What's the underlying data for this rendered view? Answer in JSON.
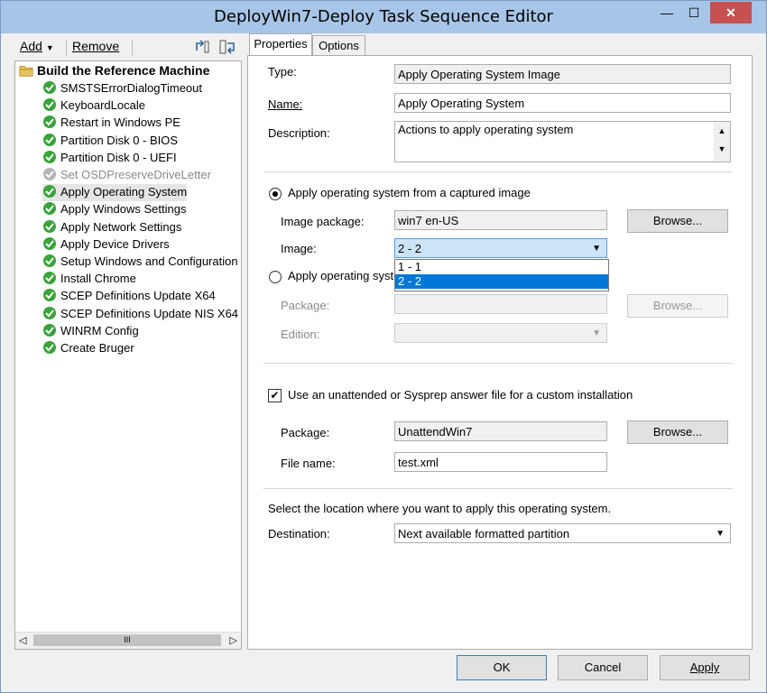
{
  "window": {
    "title": "DeployWin7-Deploy Task Sequence Editor",
    "min_glyph": "—",
    "max_glyph": "☐",
    "close_glyph": "✕"
  },
  "toolbar": {
    "add_label": "Add",
    "remove_label": "Remove"
  },
  "tree": {
    "root": "Build the Reference Machine",
    "items": [
      {
        "label": "SMSTSErrorDialogTimeout",
        "state": "ok"
      },
      {
        "label": "KeyboardLocale",
        "state": "ok"
      },
      {
        "label": "Restart in Windows PE",
        "state": "ok"
      },
      {
        "label": "Partition Disk 0 - BIOS",
        "state": "ok"
      },
      {
        "label": "Partition Disk 0 - UEFI",
        "state": "ok"
      },
      {
        "label": "Set OSDPreserveDriveLetter",
        "state": "disabled"
      },
      {
        "label": "Apply Operating System",
        "state": "ok"
      },
      {
        "label": "Apply Windows Settings",
        "state": "ok"
      },
      {
        "label": "Apply Network Settings",
        "state": "ok"
      },
      {
        "label": "Apply Device Drivers",
        "state": "ok"
      },
      {
        "label": "Setup Windows and Configuration",
        "state": "ok"
      },
      {
        "label": "Install Chrome",
        "state": "ok"
      },
      {
        "label": "SCEP Definitions Update X64",
        "state": "ok"
      },
      {
        "label": "SCEP Definitions Update NIS X64",
        "state": "ok"
      },
      {
        "label": "WINRM Config",
        "state": "ok"
      },
      {
        "label": "Create Bruger",
        "state": "ok"
      }
    ],
    "scroll_mid": "III"
  },
  "tabs": {
    "properties": "Properties",
    "options": "Options"
  },
  "props": {
    "type_label": "Type:",
    "type_value": "Apply Operating System Image",
    "name_label": "Name:",
    "name_value": "Apply Operating System",
    "description_label": "Description:",
    "description_value": "Actions to apply operating system",
    "radio_captured": "Apply operating system from a captured image",
    "image_package_label": "Image package:",
    "image_package_value": "win7  en-US",
    "browse": "Browse...",
    "image_label": "Image:",
    "image_value": "2 - 2",
    "image_options": [
      "1 - 1",
      "2 - 2"
    ],
    "radio_other": "Apply operating syste",
    "package_label": "Package:",
    "edition_label": "Edition:",
    "unattend_check": "Use an unattended or Sysprep answer file for a custom installation",
    "unattend_package_label": "Package:",
    "unattend_package_value": "UnattendWin7",
    "file_name_label": "File name:",
    "file_name_value": "test.xml",
    "location_text": "Select the location where you want to apply this operating system.",
    "destination_label": "Destination:",
    "destination_value": "Next available formatted partition"
  },
  "buttons": {
    "ok": "OK",
    "cancel": "Cancel",
    "apply": "Apply"
  }
}
